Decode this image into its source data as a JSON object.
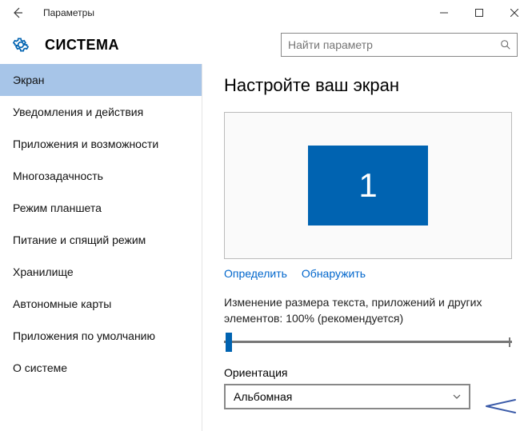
{
  "window": {
    "title": "Параметры"
  },
  "header": {
    "title": "СИСТЕМА"
  },
  "search": {
    "placeholder": "Найти параметр"
  },
  "sidebar": {
    "items": [
      {
        "label": "Экран",
        "active": true
      },
      {
        "label": "Уведомления и действия"
      },
      {
        "label": "Приложения и возможности"
      },
      {
        "label": "Многозадачность"
      },
      {
        "label": "Режим планшета"
      },
      {
        "label": "Питание и спящий режим"
      },
      {
        "label": "Хранилище"
      },
      {
        "label": "Автономные карты"
      },
      {
        "label": "Приложения по умолчанию"
      },
      {
        "label": "О системе"
      }
    ]
  },
  "main": {
    "title": "Настройте ваш экран",
    "monitor_label": "1",
    "links": {
      "identify": "Определить",
      "detect": "Обнаружить"
    },
    "scale_text": "Изменение размера текста, приложений и других элементов: 100% (рекомендуется)",
    "orientation": {
      "label": "Ориентация",
      "value": "Альбомная"
    }
  }
}
